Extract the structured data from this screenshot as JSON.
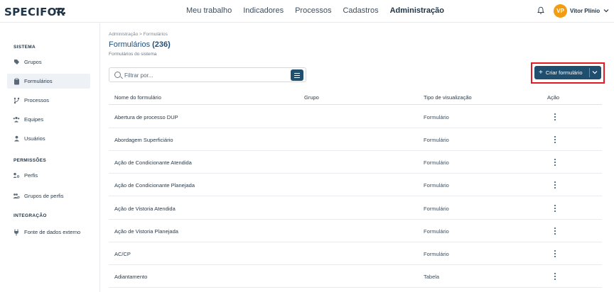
{
  "header": {
    "logo": "SPECIFOR",
    "nav": [
      "Meu trabalho",
      "Indicadores",
      "Processos",
      "Cadastros",
      "Administração"
    ],
    "active_nav": "Administração",
    "user_initials": "VP",
    "user_name": "Vitor Plínio",
    "icons": [
      "bell-icon",
      "chevron-down-icon"
    ]
  },
  "sidebar": {
    "sections": [
      {
        "title": "SISTEMA",
        "items": [
          {
            "label": "Grupos",
            "icon": "tag-icon"
          },
          {
            "label": "Formulários",
            "icon": "clipboard-icon",
            "active": true
          },
          {
            "label": "Processos",
            "icon": "flow-icon"
          },
          {
            "label": "Equipes",
            "icon": "team-icon"
          },
          {
            "label": "Usuários",
            "icon": "user-icon"
          }
        ]
      },
      {
        "title": "PERMISSÕES",
        "items": [
          {
            "label": "Perfis",
            "icon": "profile-key-icon"
          },
          {
            "label": "Grupos de perfis",
            "icon": "profile-group-icon"
          }
        ]
      },
      {
        "title": "INTEGRAÇÃO",
        "items": [
          {
            "label": "Fonte de dados externo",
            "icon": "plug-icon"
          }
        ]
      }
    ]
  },
  "main": {
    "breadcrumb": "Administração > Formulários",
    "title": "Formulários",
    "count": "(236)",
    "subtitle": "Formulários do sistema",
    "search_placeholder": "Filtrar por...",
    "create_button": "Criar formulário",
    "table": {
      "columns": [
        "Nome do formulário",
        "Grupo",
        "Tipo de visualização",
        "Ação"
      ],
      "rows": [
        {
          "name": "Abertura de processo DUP",
          "group": "",
          "type": "Formulário"
        },
        {
          "name": "Abordagem Superficiário",
          "group": "",
          "type": "Formulário"
        },
        {
          "name": "Ação de Condicionante Atendida",
          "group": "",
          "type": "Formulário"
        },
        {
          "name": "Ação de Condicionante Planejada",
          "group": "",
          "type": "Formulário"
        },
        {
          "name": "Ação de Vistoria Atendida",
          "group": "",
          "type": "Formulário"
        },
        {
          "name": "Ação de Vistoria Planejada",
          "group": "",
          "type": "Formulário"
        },
        {
          "name": "AC/CP",
          "group": "",
          "type": "Formulário"
        },
        {
          "name": "Adiantamento",
          "group": "",
          "type": "Tabela"
        }
      ]
    }
  },
  "colors": {
    "primary": "#1f4e6e",
    "accent_avatar": "#f39c12",
    "highlight_box": "#e41b23",
    "title_blue": "#1f4e79"
  }
}
